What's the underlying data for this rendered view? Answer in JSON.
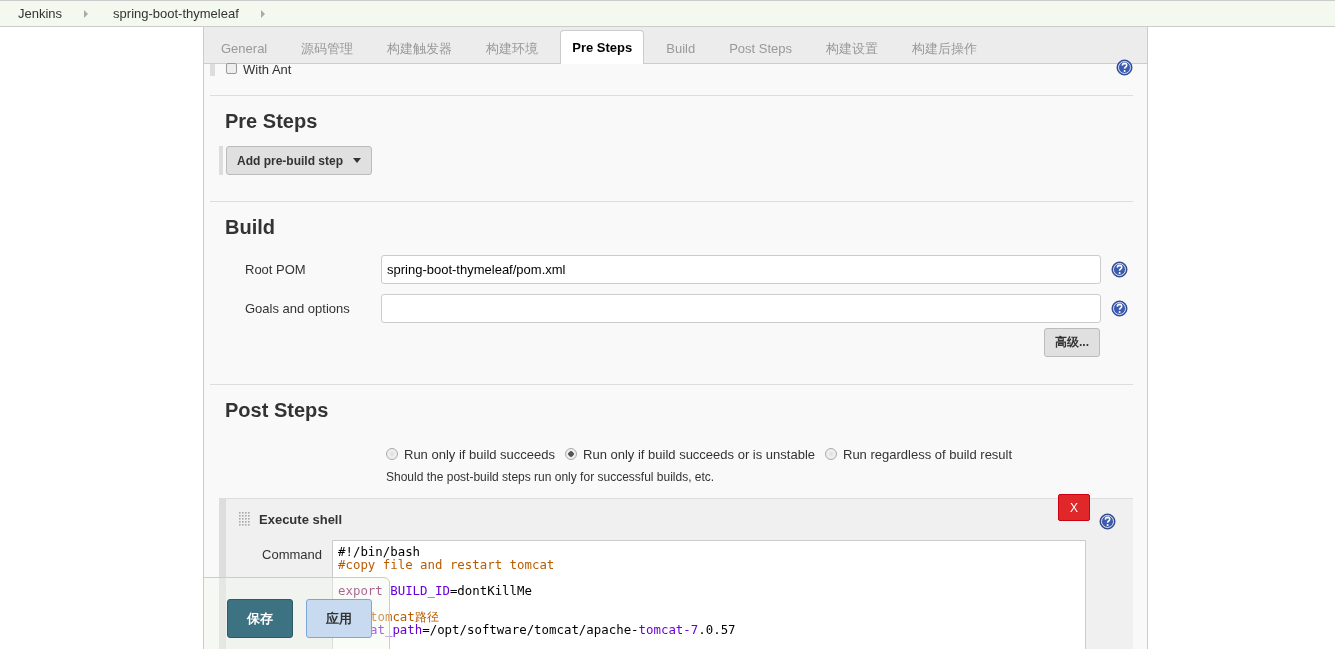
{
  "breadcrumbs": [
    "Jenkins",
    "spring-boot-thymeleaf"
  ],
  "tabs": [
    {
      "label": "General",
      "selected": false
    },
    {
      "label": "源码管理",
      "selected": false
    },
    {
      "label": "构建触发器",
      "selected": false
    },
    {
      "label": "构建环境",
      "selected": false
    },
    {
      "label": "Pre Steps",
      "selected": true
    },
    {
      "label": "Build",
      "selected": false
    },
    {
      "label": "Post Steps",
      "selected": false
    },
    {
      "label": "构建设置",
      "selected": false
    },
    {
      "label": "构建后操作",
      "selected": false
    }
  ],
  "with_ant": {
    "label": "With Ant",
    "checked": false
  },
  "pre_steps": {
    "title": "Pre Steps",
    "add_button": "Add pre-build step"
  },
  "build": {
    "title": "Build",
    "fields": [
      {
        "label": "Root POM",
        "value": "spring-boot-thymeleaf/pom.xml"
      },
      {
        "label": "Goals and options"
      }
    ],
    "advanced_button": "高级..."
  },
  "post_steps": {
    "title": "Post Steps",
    "options": [
      {
        "label": "Run only if build succeeds",
        "selected": false
      },
      {
        "label": "Run only if build succeeds or is unstable",
        "selected": true
      },
      {
        "label": "Run regardless of build result",
        "selected": false
      }
    ],
    "hint": "Should the post-build steps run only for successful builds, etc.",
    "step": {
      "title": "Execute shell",
      "delete_button": "X",
      "command_label": "Command",
      "lines": [
        {
          "kind": "full",
          "tokens": [
            {
              "kind": "plain",
              "text": "#!/bin/bash"
            }
          ]
        },
        {
          "kind": "full",
          "tokens": [
            {
              "kind": "comment",
              "text": "#copy file and restart tomcat"
            }
          ]
        },
        {
          "kind": "full"
        },
        {
          "kind": "full",
          "tokens": [
            {
              "kind": "keyword",
              "text": "export"
            },
            {
              "kind": "variable",
              "text": " BUILD_ID"
            },
            {
              "kind": "plain",
              "text": "=dontKillMe"
            }
          ]
        },
        {
          "kind": "full"
        },
        {
          "kind": "covered",
          "tokens": [
            {
              "kind": "comment",
              "text": "tomcat路径"
            }
          ]
        },
        {
          "kind": "covered",
          "tokens": [
            {
              "kind": "variable",
              "text": "at_path"
            },
            {
              "kind": "plain",
              "text": "=/opt/software/tomcat/apache-"
            },
            {
              "kind": "variable",
              "text": "tomcat-7"
            },
            {
              "kind": "plain",
              "text": ".0.57"
            }
          ]
        }
      ]
    }
  },
  "save_bar": {
    "buttons": [
      {
        "label": "保存",
        "kind": "primary"
      },
      {
        "label": "应用",
        "kind": "secondary"
      }
    ]
  }
}
